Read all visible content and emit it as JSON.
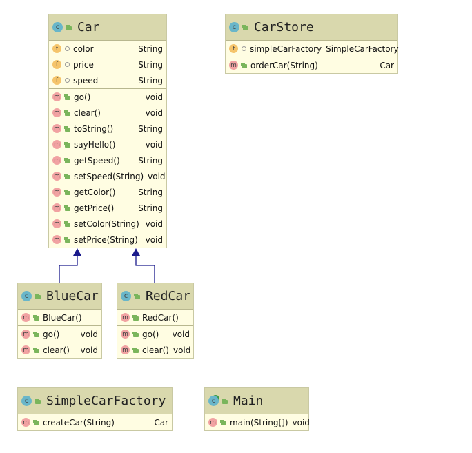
{
  "diagram": {
    "classes": [
      {
        "id": "car",
        "name": "Car",
        "icon": "class-icon",
        "sections": [
          [
            {
              "kind": "field",
              "visibility": "package",
              "label": "color",
              "type": "String"
            },
            {
              "kind": "field",
              "visibility": "package",
              "label": "price",
              "type": "String"
            },
            {
              "kind": "field",
              "visibility": "package",
              "label": "speed",
              "type": "String"
            }
          ],
          [
            {
              "kind": "method",
              "visibility": "public",
              "label": "go()",
              "type": "void"
            },
            {
              "kind": "method",
              "visibility": "public",
              "label": "clear()",
              "type": "void"
            },
            {
              "kind": "method",
              "visibility": "public",
              "label": "toString()",
              "type": "String"
            },
            {
              "kind": "method",
              "visibility": "public",
              "label": "sayHello()",
              "type": "void"
            },
            {
              "kind": "method",
              "visibility": "public",
              "label": "getSpeed()",
              "type": "String"
            },
            {
              "kind": "method",
              "visibility": "public",
              "label": "setSpeed(String)",
              "type": "void"
            },
            {
              "kind": "method",
              "visibility": "public",
              "label": "getColor()",
              "type": "String"
            },
            {
              "kind": "method",
              "visibility": "public",
              "label": "getPrice()",
              "type": "String"
            },
            {
              "kind": "method",
              "visibility": "public",
              "label": "setColor(String)",
              "type": "void"
            },
            {
              "kind": "method",
              "visibility": "public",
              "label": "setPrice(String)",
              "type": "void"
            }
          ]
        ]
      },
      {
        "id": "carstore",
        "name": "CarStore",
        "icon": "class-icon",
        "sections": [
          [
            {
              "kind": "field",
              "visibility": "package",
              "label": "simpleCarFactory",
              "type": "SimpleCarFactory"
            }
          ],
          [
            {
              "kind": "method",
              "visibility": "public",
              "label": "orderCar(String)",
              "type": "Car"
            }
          ]
        ]
      },
      {
        "id": "bluecar",
        "name": "BlueCar",
        "icon": "class-icon",
        "sections": [
          [
            {
              "kind": "method",
              "visibility": "public",
              "label": "BlueCar()",
              "type": ""
            }
          ],
          [
            {
              "kind": "method",
              "visibility": "public",
              "label": "go()",
              "type": "void"
            },
            {
              "kind": "method",
              "visibility": "public",
              "label": "clear()",
              "type": "void"
            }
          ]
        ]
      },
      {
        "id": "redcar",
        "name": "RedCar",
        "icon": "class-icon",
        "sections": [
          [
            {
              "kind": "method",
              "visibility": "public",
              "label": "RedCar()",
              "type": ""
            }
          ],
          [
            {
              "kind": "method",
              "visibility": "public",
              "label": "go()",
              "type": "void"
            },
            {
              "kind": "method",
              "visibility": "public",
              "label": "clear()",
              "type": "void"
            }
          ]
        ]
      },
      {
        "id": "simplecarfactory",
        "name": "SimpleCarFactory",
        "icon": "class-icon",
        "sections": [
          [
            {
              "kind": "method",
              "visibility": "public",
              "label": "createCar(String)",
              "type": "Car"
            }
          ]
        ]
      },
      {
        "id": "main",
        "name": "Main",
        "icon": "runnable-class-icon",
        "sections": [
          [
            {
              "kind": "method",
              "visibility": "public",
              "label": "main(String[])",
              "type": "void"
            }
          ]
        ]
      }
    ],
    "relations": [
      {
        "type": "inheritance",
        "from": "bluecar",
        "to": "car"
      },
      {
        "type": "inheritance",
        "from": "redcar",
        "to": "car"
      }
    ],
    "colors": {
      "header": "#d9d8ad",
      "body": "#fffde2",
      "arrow": "#1a1a8c"
    }
  }
}
